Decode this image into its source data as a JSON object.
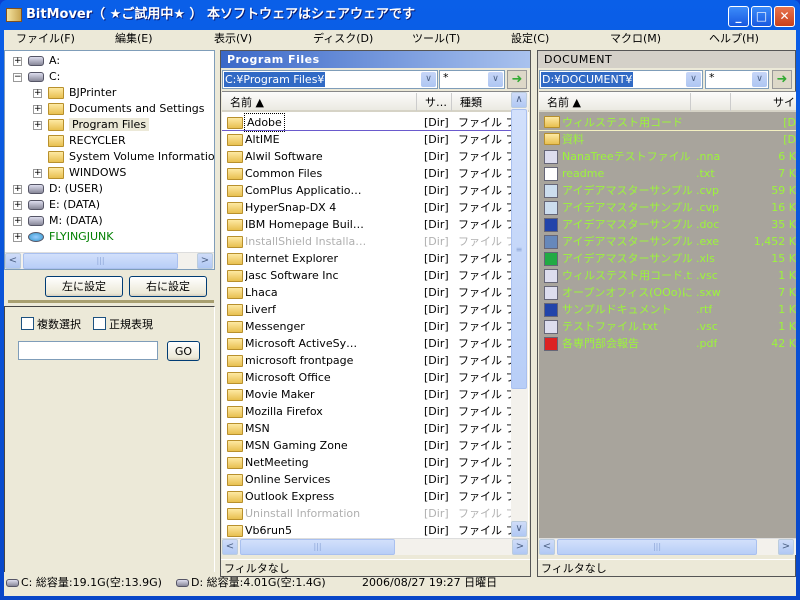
{
  "window": {
    "title": "BitMover（ ★ご試用中★ ） 本ソフトウェアはシェアウェアです",
    "min": "_",
    "max": "□",
    "close": "✕"
  },
  "menu": [
    "ファイル(F)",
    "編集(E)",
    "表示(V)",
    "ディスク(D)",
    "ツール(T)",
    "設定(C)",
    "マクロ(M)",
    "ヘルプ(H)"
  ],
  "tree": [
    {
      "label": "A:",
      "level": 0,
      "exp": "+",
      "icon": "floppy-drive-icon"
    },
    {
      "label": "C:",
      "level": 0,
      "exp": "−",
      "icon": "hard-drive-icon"
    },
    {
      "label": "BJPrinter",
      "level": 1,
      "exp": "+",
      "icon": "folder-icon"
    },
    {
      "label": "Documents and Settings",
      "level": 1,
      "exp": "+",
      "icon": "folder-icon"
    },
    {
      "label": "Program Files",
      "level": 1,
      "exp": "+",
      "icon": "folder-icon",
      "selected": true
    },
    {
      "label": "RECYCLER",
      "level": 1,
      "exp": "",
      "icon": "folder-icon"
    },
    {
      "label": "System Volume Information",
      "level": 1,
      "exp": "",
      "icon": "folder-icon"
    },
    {
      "label": "WINDOWS",
      "level": 1,
      "exp": "+",
      "icon": "folder-icon"
    },
    {
      "label": "D: (USER)",
      "level": 0,
      "exp": "+",
      "icon": "hard-drive-icon"
    },
    {
      "label": "E: (DATA)",
      "level": 0,
      "exp": "+",
      "icon": "hard-drive-icon"
    },
    {
      "label": "M: (DATA)",
      "level": 0,
      "exp": "+",
      "icon": "hard-drive-icon"
    },
    {
      "label": "FLYINGJUNK",
      "level": 0,
      "exp": "+",
      "icon": "network-icon",
      "color": "#008000"
    }
  ],
  "left": {
    "set_left": "左に設定",
    "set_right": "右に設定",
    "multi_select": "複数選択",
    "regex": "正規表現",
    "search_value": "",
    "go": "GO"
  },
  "middle": {
    "title": "Program Files",
    "path": "C:¥Program Files¥",
    "filter": "*",
    "col_name": "名前 ▲",
    "col_size": "サ…",
    "col_type": "種類",
    "status": "フィルタなし",
    "rows": [
      [
        "Adobe",
        "[Dir]",
        "ファイル フォ"
      ],
      [
        "AltIME",
        "[Dir]",
        "ファイル フォ"
      ],
      [
        "Alwil Software",
        "[Dir]",
        "ファイル フォ"
      ],
      [
        "Common Files",
        "[Dir]",
        "ファイル フォ"
      ],
      [
        "ComPlus Applicatio…",
        "[Dir]",
        "ファイル フォ"
      ],
      [
        "HyperSnap-DX 4",
        "[Dir]",
        "ファイル フォ"
      ],
      [
        "IBM Homepage Buil…",
        "[Dir]",
        "ファイル フォ"
      ],
      [
        "InstallShield Installa…",
        "[Dir]",
        "ファイル フォ"
      ],
      [
        "Internet Explorer",
        "[Dir]",
        "ファイル フォ"
      ],
      [
        "Jasc Software Inc",
        "[Dir]",
        "ファイル フォ"
      ],
      [
        "Lhaca",
        "[Dir]",
        "ファイル フォ"
      ],
      [
        "Liverf",
        "[Dir]",
        "ファイル フォ"
      ],
      [
        "Messenger",
        "[Dir]",
        "ファイル フォ"
      ],
      [
        "Microsoft ActiveSy…",
        "[Dir]",
        "ファイル フォ"
      ],
      [
        "microsoft frontpage",
        "[Dir]",
        "ファイル フォ"
      ],
      [
        "Microsoft Office",
        "[Dir]",
        "ファイル フォ"
      ],
      [
        "Movie Maker",
        "[Dir]",
        "ファイル フォ"
      ],
      [
        "Mozilla Firefox",
        "[Dir]",
        "ファイル フォ"
      ],
      [
        "MSN",
        "[Dir]",
        "ファイル フォ"
      ],
      [
        "MSN Gaming Zone",
        "[Dir]",
        "ファイル フォ"
      ],
      [
        "NetMeeting",
        "[Dir]",
        "ファイル フォ"
      ],
      [
        "Online Services",
        "[Dir]",
        "ファイル フォ"
      ],
      [
        "Outlook Express",
        "[Dir]",
        "ファイル フォ"
      ],
      [
        "Uninstall Information",
        "[Dir]",
        "ファイル フォ"
      ],
      [
        "Vb6run5",
        "[Dir]",
        "ファイル フォ"
      ]
    ],
    "hidden_rows": [
      7,
      23
    ]
  },
  "right": {
    "title": "DOCUMENT",
    "path": "D:¥DOCUMENT¥",
    "filter": "*",
    "col_name": "名前 ▲",
    "col_size": "サイ",
    "status": "フィルタなし",
    "rows": [
      [
        "ウィルステスト用コード",
        "",
        "[D",
        "folder-icon"
      ],
      [
        "資料",
        "",
        "[D",
        "folder-icon"
      ],
      [
        "NanaTreeテストファイル",
        ".nna",
        "6 K",
        "app-file-icon"
      ],
      [
        "readme",
        ".txt",
        "7 K",
        "text-file-icon"
      ],
      [
        "アイデアマスターサンプル1",
        ".cvp",
        "59 K",
        "cvp-file-icon"
      ],
      [
        "アイデアマスターサンプル2",
        ".cvp",
        "16 K",
        "cvp-file-icon"
      ],
      [
        "アイデアマスターサンプル2",
        ".doc",
        "35 K",
        "word-file-icon"
      ],
      [
        "アイデアマスターサンプル2",
        ".exe",
        "1,452 K",
        "exe-file-icon"
      ],
      [
        "アイデアマスターサンプル2",
        ".xls",
        "15 K",
        "excel-file-icon"
      ],
      [
        "ウィルステスト用コード.txt",
        ".vsc",
        "1 K",
        "app-file-icon"
      ],
      [
        "オープンオフィス(OOo)につ…",
        ".sxw",
        "7 K",
        "app-file-icon"
      ],
      [
        "サンプルドキュメント",
        ".rtf",
        "1 K",
        "word-file-icon"
      ],
      [
        "テストファイル.txt",
        ".vsc",
        "1 K",
        "app-file-icon"
      ],
      [
        "各専門部会報告",
        ".pdf",
        "42 K",
        "pdf-file-icon"
      ]
    ]
  },
  "statusbar": {
    "c_drive": "C: 総容量:19.1G(空:13.9G)",
    "d_drive": "D: 総容量:4.01G(空:1.4G)",
    "datetime": "2006/08/27 19:27 日曜日"
  },
  "colors": {
    "right_pane_bg": "#a8a49c",
    "right_pane_text": "#9cf53a",
    "title_bar": "#0a5fe8",
    "disabled_text": "#b0b0b0"
  }
}
